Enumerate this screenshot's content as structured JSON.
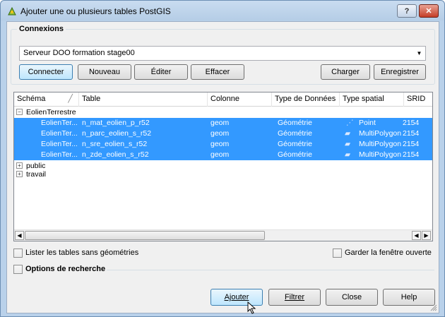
{
  "window": {
    "title": "Ajouter une ou plusieurs tables PostGIS",
    "help_label": "?",
    "close_label": "✕"
  },
  "connections": {
    "group_title": "Connexions",
    "selected": "Serveur DOO formation stage00",
    "buttons": {
      "connect": "Connecter",
      "new": "Nouveau",
      "edit": "Éditer",
      "delete": "Effacer",
      "load": "Charger",
      "save": "Enregistrer"
    }
  },
  "table": {
    "headers": [
      "Schéma",
      "Table",
      "Colonne",
      "Type de Données",
      "Type spatial",
      "SRID"
    ],
    "schemas": [
      {
        "name": "EolienTerrestre",
        "rows": [
          {
            "schema": "EolienTer...",
            "table": "n_mat_eolien_p_r52",
            "column": "geom",
            "datatype": "Géométrie",
            "spatial": "Point",
            "srid": "2154"
          },
          {
            "schema": "EolienTer...",
            "table": "n_parc_eolien_s_r52",
            "column": "geom",
            "datatype": "Géométrie",
            "spatial": "MultiPolygon",
            "srid": "2154"
          },
          {
            "schema": "EolienTer...",
            "table": "n_sre_eolien_s_r52",
            "column": "geom",
            "datatype": "Géométrie",
            "spatial": "MultiPolygon",
            "srid": "2154"
          },
          {
            "schema": "EolienTer...",
            "table": "n_zde_eolien_s_r52",
            "column": "geom",
            "datatype": "Géométrie",
            "spatial": "MultiPolygon",
            "srid": "2154"
          }
        ]
      },
      {
        "name": "public"
      },
      {
        "name": "travail"
      }
    ]
  },
  "options": {
    "list_no_geom": "Lister les tables sans géométries",
    "keep_open": "Garder la fenêtre ouverte",
    "search_options": "Options de recherche"
  },
  "footer": {
    "add": "Ajouter",
    "filter": "Filtrer",
    "close": "Close",
    "help": "Help"
  }
}
